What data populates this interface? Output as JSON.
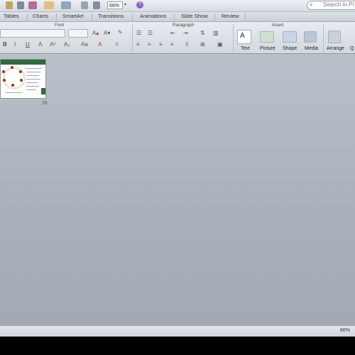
{
  "toolbar": {
    "zoom_value": "66%",
    "help_glyph": "?",
    "search_placeholder": "Search in Pr",
    "icons": [
      "paste-icon",
      "undo-icon",
      "format-painter-icon",
      "new-slide-icon",
      "layout-icon",
      "print-icon",
      "gallery-icon",
      "help-icon",
      "search-icon"
    ]
  },
  "tabs": [
    "Tables",
    "Charts",
    "SmartArt",
    "Transitions",
    "Animations",
    "Slide Show",
    "Review"
  ],
  "ribbon": {
    "groups": {
      "font": "Font",
      "paragraph": "Paragraph",
      "insert": "Insert"
    },
    "buttons": {
      "text": "Text",
      "picture": "Picture",
      "shape": "Shape",
      "media": "Media",
      "arrange": "Arrange",
      "quick": "Q"
    }
  },
  "thumbnail": {
    "caption": "26"
  },
  "status": {
    "zoom": "66%"
  },
  "colors": {
    "ribbon_bg": "#dfe3e9",
    "canvas_bg": "#a9b1bd",
    "slide_header": "#2f6b3a",
    "help_purple": "#8a63c7"
  }
}
